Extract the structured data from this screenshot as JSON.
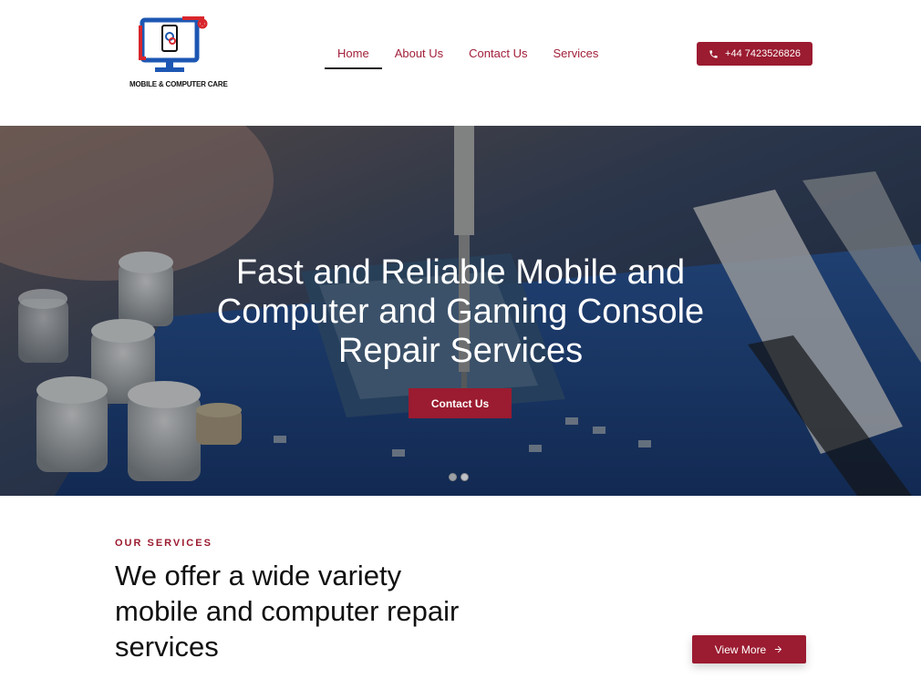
{
  "header": {
    "logo_text": "MOBILE & COMPUTER CARE",
    "nav": [
      {
        "label": "Home",
        "active": true
      },
      {
        "label": "About Us",
        "active": false
      },
      {
        "label": "Contact Us",
        "active": false
      },
      {
        "label": "Services",
        "active": false
      }
    ],
    "phone": "+44 7423526826"
  },
  "hero": {
    "title": "Fast and Reliable Mobile and Computer and Gaming Console Repair Services",
    "cta_label": "Contact Us",
    "slides": 2,
    "active_slide": 1
  },
  "services": {
    "eyebrow": "OUR SERVICES",
    "heading": "We offer a wide variety mobile and computer repair services",
    "view_more_label": "View More"
  },
  "colors": {
    "brand": "#9b1b30",
    "nav_text": "#a2203a"
  },
  "icons": [
    "phone-icon",
    "arrow-right-icon"
  ]
}
